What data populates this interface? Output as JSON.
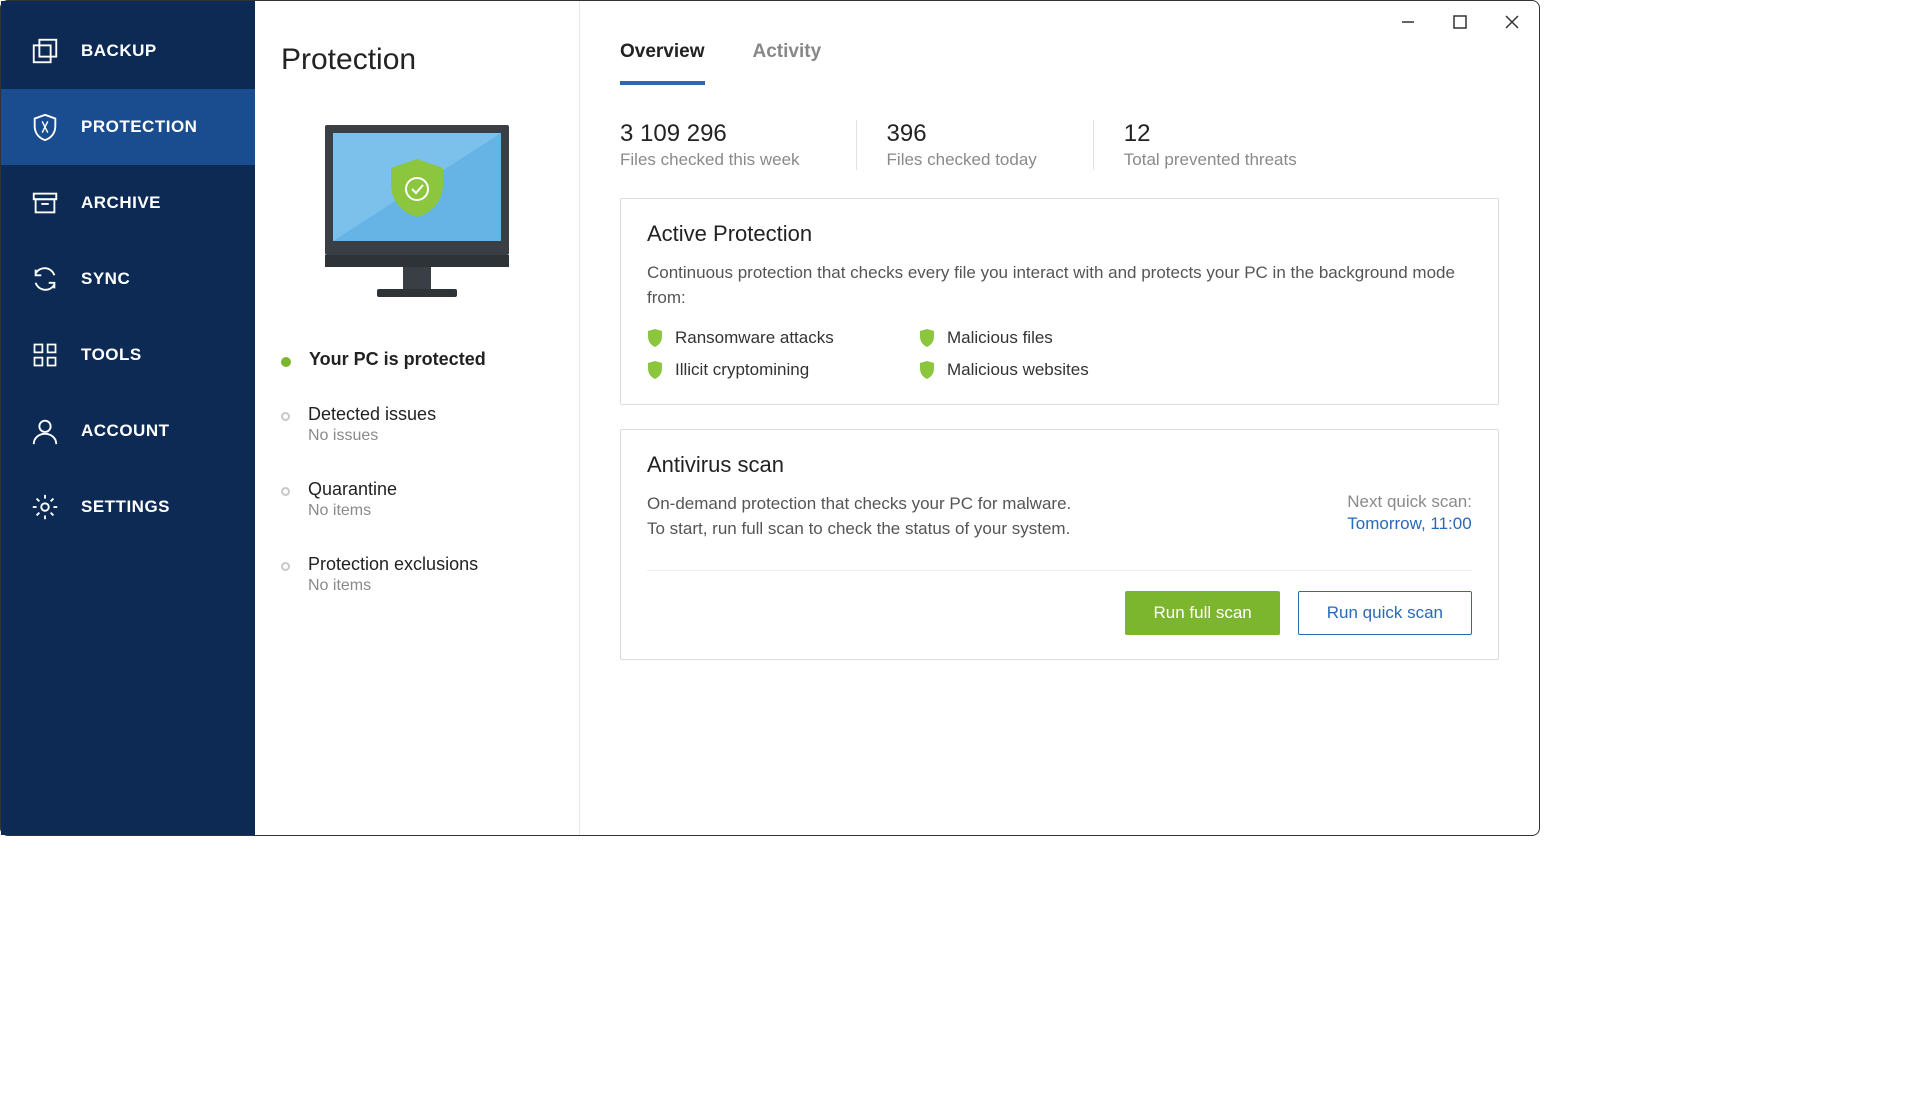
{
  "sidebar": {
    "items": [
      {
        "label": "BACKUP"
      },
      {
        "label": "PROTECTION"
      },
      {
        "label": "ARCHIVE"
      },
      {
        "label": "SYNC"
      },
      {
        "label": "TOOLS"
      },
      {
        "label": "ACCOUNT"
      },
      {
        "label": "SETTINGS"
      }
    ]
  },
  "mid": {
    "title": "Protection",
    "status_main": "Your PC is protected",
    "rows": [
      {
        "title": "Detected issues",
        "sub": "No issues"
      },
      {
        "title": "Quarantine",
        "sub": "No items"
      },
      {
        "title": "Protection exclusions",
        "sub": "No items"
      }
    ]
  },
  "main": {
    "tabs": [
      {
        "label": "Overview"
      },
      {
        "label": "Activity"
      }
    ],
    "stats": [
      {
        "num": "3 109 296",
        "lbl": "Files checked this week"
      },
      {
        "num": "396",
        "lbl": "Files checked today"
      },
      {
        "num": "12",
        "lbl": "Total prevented threats"
      }
    ],
    "active_protection": {
      "title": "Active Protection",
      "desc": "Continuous protection that checks every file you interact with and protects your PC in the background mode from:",
      "threats": [
        "Ransomware attacks",
        "Malicious files",
        "Illicit cryptomining",
        "Malicious websites"
      ]
    },
    "antivirus": {
      "title": "Antivirus scan",
      "desc": "On-demand protection that checks your PC for malware. To start, run full scan to check the status of your system.",
      "next_label": "Next quick scan:",
      "next_value": "Tomorrow, 11:00",
      "btn_full": "Run full scan",
      "btn_quick": "Run quick scan"
    }
  },
  "colors": {
    "accent_green": "#7cb62e",
    "accent_blue": "#2a69b8"
  }
}
